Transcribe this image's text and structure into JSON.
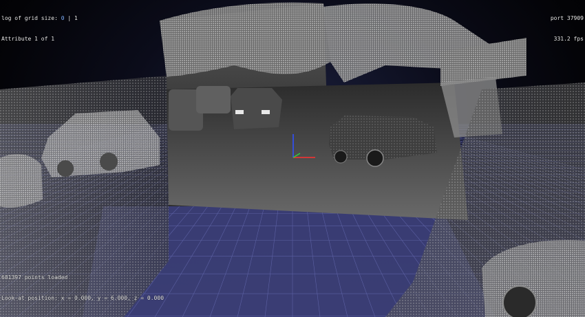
{
  "hud": {
    "grid_label": "log of grid size:",
    "grid_value": "0",
    "grid_separator": "|",
    "grid_extra": "1",
    "attribute": "Attribute 1 of 1",
    "port": "port 37909",
    "fps": "331.2 fps",
    "points_loaded": "681397 points loaded",
    "look_at": "Look-at position: x = 0.000, y = 6.000, z = 0.000"
  },
  "colors": {
    "ground_grid": "#3c3f78",
    "grid_line": "#6b70b8",
    "axis_x": "#ff3030",
    "axis_y": "#30d040",
    "axis_z": "#3050ff",
    "point_cloud": "#bdbdbd"
  }
}
